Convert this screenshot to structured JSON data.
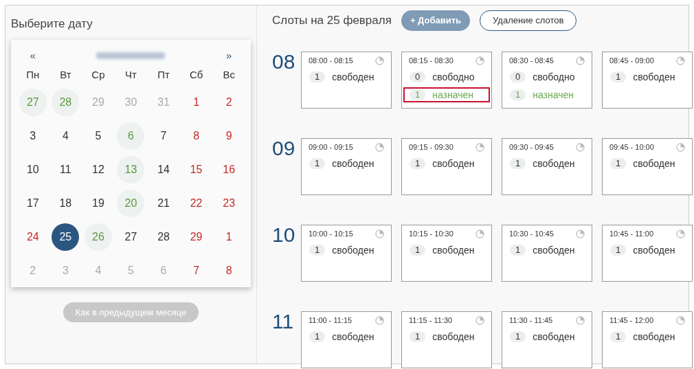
{
  "date_picker": {
    "title": "Выберите дату",
    "prev": "«",
    "next": "»",
    "weekdays": [
      "Пн",
      "Вт",
      "Ср",
      "Чт",
      "Пт",
      "Сб",
      "Вс"
    ],
    "days": [
      {
        "label": "27",
        "color": "#5a9a3c",
        "has_slots": true,
        "selected": false
      },
      {
        "label": "28",
        "color": "#5a9a3c",
        "has_slots": true,
        "selected": false
      },
      {
        "label": "29",
        "color": "#aaaaaa",
        "has_slots": false,
        "selected": false
      },
      {
        "label": "30",
        "color": "#aaaaaa",
        "has_slots": false,
        "selected": false
      },
      {
        "label": "31",
        "color": "#aaaaaa",
        "has_slots": false,
        "selected": false
      },
      {
        "label": "1",
        "color": "#c62828",
        "has_slots": false,
        "selected": false
      },
      {
        "label": "2",
        "color": "#c62828",
        "has_slots": false,
        "selected": false
      },
      {
        "label": "3",
        "color": "#333333",
        "has_slots": false,
        "selected": false
      },
      {
        "label": "4",
        "color": "#333333",
        "has_slots": false,
        "selected": false
      },
      {
        "label": "5",
        "color": "#333333",
        "has_slots": false,
        "selected": false
      },
      {
        "label": "6",
        "color": "#5a9a3c",
        "has_slots": true,
        "selected": false
      },
      {
        "label": "7",
        "color": "#333333",
        "has_slots": false,
        "selected": false
      },
      {
        "label": "8",
        "color": "#c62828",
        "has_slots": false,
        "selected": false
      },
      {
        "label": "9",
        "color": "#c62828",
        "has_slots": false,
        "selected": false
      },
      {
        "label": "10",
        "color": "#333333",
        "has_slots": false,
        "selected": false
      },
      {
        "label": "11",
        "color": "#333333",
        "has_slots": false,
        "selected": false
      },
      {
        "label": "12",
        "color": "#333333",
        "has_slots": false,
        "selected": false
      },
      {
        "label": "13",
        "color": "#5a9a3c",
        "has_slots": true,
        "selected": false
      },
      {
        "label": "14",
        "color": "#333333",
        "has_slots": false,
        "selected": false
      },
      {
        "label": "15",
        "color": "#c62828",
        "has_slots": false,
        "selected": false
      },
      {
        "label": "16",
        "color": "#c62828",
        "has_slots": false,
        "selected": false
      },
      {
        "label": "17",
        "color": "#333333",
        "has_slots": false,
        "selected": false
      },
      {
        "label": "18",
        "color": "#333333",
        "has_slots": false,
        "selected": false
      },
      {
        "label": "19",
        "color": "#333333",
        "has_slots": false,
        "selected": false
      },
      {
        "label": "20",
        "color": "#5a9a3c",
        "has_slots": true,
        "selected": false
      },
      {
        "label": "21",
        "color": "#333333",
        "has_slots": false,
        "selected": false
      },
      {
        "label": "22",
        "color": "#c62828",
        "has_slots": false,
        "selected": false
      },
      {
        "label": "23",
        "color": "#c62828",
        "has_slots": false,
        "selected": false
      },
      {
        "label": "24",
        "color": "#c62828",
        "has_slots": false,
        "selected": false
      },
      {
        "label": "25",
        "color": "#2b5680",
        "has_slots": true,
        "selected": true
      },
      {
        "label": "26",
        "color": "#5a9a3c",
        "has_slots": true,
        "selected": false
      },
      {
        "label": "27",
        "color": "#333333",
        "has_slots": false,
        "selected": false
      },
      {
        "label": "28",
        "color": "#333333",
        "has_slots": false,
        "selected": false
      },
      {
        "label": "29",
        "color": "#c62828",
        "has_slots": false,
        "selected": false
      },
      {
        "label": "1",
        "color": "#c62828",
        "has_slots": false,
        "selected": false
      },
      {
        "label": "2",
        "color": "#aaaaaa",
        "has_slots": false,
        "selected": false
      },
      {
        "label": "3",
        "color": "#aaaaaa",
        "has_slots": false,
        "selected": false
      },
      {
        "label": "4",
        "color": "#aaaaaa",
        "has_slots": false,
        "selected": false
      },
      {
        "label": "5",
        "color": "#aaaaaa",
        "has_slots": false,
        "selected": false
      },
      {
        "label": "6",
        "color": "#aaaaaa",
        "has_slots": false,
        "selected": false
      },
      {
        "label": "7",
        "color": "#c62828",
        "has_slots": false,
        "selected": false
      },
      {
        "label": "8",
        "color": "#c62828",
        "has_slots": false,
        "selected": false
      }
    ],
    "copy_button": {
      "label": "Как в предыдущем месяце",
      "disabled": true
    }
  },
  "slots": {
    "title": "Слоты на 25 февраля",
    "add_button": "+ Добавить",
    "delete_button": "Удаление слотов",
    "hours": [
      {
        "hour": "08",
        "cells": [
          {
            "time": "08:00 - 08:15",
            "statuses": [
              {
                "count": "1",
                "label": "свободен",
                "kind": "free",
                "highlighted": false
              }
            ]
          },
          {
            "time": "08:15 - 08:30",
            "statuses": [
              {
                "count": "0",
                "label": "свободно",
                "kind": "free",
                "highlighted": false
              },
              {
                "count": "1",
                "label": "назначен",
                "kind": "assigned",
                "highlighted": true
              }
            ]
          },
          {
            "time": "08:30 - 08:45",
            "statuses": [
              {
                "count": "0",
                "label": "свободно",
                "kind": "free",
                "highlighted": false
              },
              {
                "count": "1",
                "label": "назначен",
                "kind": "assigned",
                "highlighted": false
              }
            ]
          },
          {
            "time": "08:45 - 09:00",
            "statuses": [
              {
                "count": "1",
                "label": "свободен",
                "kind": "free",
                "highlighted": false
              }
            ]
          }
        ]
      },
      {
        "hour": "09",
        "cells": [
          {
            "time": "09:00 - 09:15",
            "statuses": [
              {
                "count": "1",
                "label": "свободен",
                "kind": "free",
                "highlighted": false
              }
            ]
          },
          {
            "time": "09:15 - 09:30",
            "statuses": [
              {
                "count": "1",
                "label": "свободен",
                "kind": "free",
                "highlighted": false
              }
            ]
          },
          {
            "time": "09:30 - 09:45",
            "statuses": [
              {
                "count": "1",
                "label": "свободен",
                "kind": "free",
                "highlighted": false
              }
            ]
          },
          {
            "time": "09:45 - 10:00",
            "statuses": [
              {
                "count": "1",
                "label": "свободен",
                "kind": "free",
                "highlighted": false
              }
            ]
          }
        ]
      },
      {
        "hour": "10",
        "cells": [
          {
            "time": "10:00 - 10:15",
            "statuses": [
              {
                "count": "1",
                "label": "свободен",
                "kind": "free",
                "highlighted": false
              }
            ]
          },
          {
            "time": "10:15 - 10:30",
            "statuses": [
              {
                "count": "1",
                "label": "свободен",
                "kind": "free",
                "highlighted": false
              }
            ]
          },
          {
            "time": "10:30 - 10:45",
            "statuses": [
              {
                "count": "1",
                "label": "свободен",
                "kind": "free",
                "highlighted": false
              }
            ]
          },
          {
            "time": "10:45 - 11:00",
            "statuses": [
              {
                "count": "1",
                "label": "свободен",
                "kind": "free",
                "highlighted": false
              }
            ]
          }
        ]
      },
      {
        "hour": "11",
        "cells": [
          {
            "time": "11:00 - 11:15",
            "statuses": [
              {
                "count": "1",
                "label": "свободен",
                "kind": "free",
                "highlighted": false
              }
            ]
          },
          {
            "time": "11:15 - 11:30",
            "statuses": [
              {
                "count": "1",
                "label": "свободен",
                "kind": "free",
                "highlighted": false
              }
            ]
          },
          {
            "time": "11:30 - 11:45",
            "statuses": [
              {
                "count": "1",
                "label": "свободен",
                "kind": "free",
                "highlighted": false
              }
            ]
          },
          {
            "time": "11:45 - 12:00",
            "statuses": [
              {
                "count": "1",
                "label": "свободен",
                "kind": "free",
                "highlighted": false
              }
            ]
          }
        ]
      }
    ]
  }
}
